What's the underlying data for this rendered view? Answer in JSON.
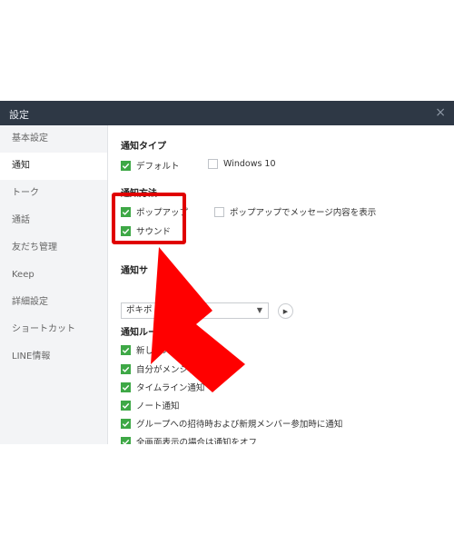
{
  "window": {
    "title": "設定",
    "close_glyph": "×"
  },
  "sidebar": {
    "items": [
      {
        "label": "基本設定",
        "active": false
      },
      {
        "label": "通知",
        "active": true
      },
      {
        "label": "トーク",
        "active": false
      },
      {
        "label": "通話",
        "active": false
      },
      {
        "label": "友だち管理",
        "active": false
      },
      {
        "label": "Keep",
        "active": false
      },
      {
        "label": "詳細設定",
        "active": false
      },
      {
        "label": "ショートカット",
        "active": false
      },
      {
        "label": "LINE情報",
        "active": false
      }
    ]
  },
  "main": {
    "notification_type": {
      "title": "通知タイプ",
      "options": [
        {
          "label": "デフォルト",
          "checked": true
        },
        {
          "label": "Windows 10",
          "checked": false
        }
      ]
    },
    "notification_method": {
      "title": "通知方法",
      "options": [
        {
          "label": "ポップアップ",
          "checked": true
        },
        {
          "label": "ポップアップでメッセージ内容を表示",
          "checked": false
        },
        {
          "label": "サウンド",
          "checked": true
        }
      ]
    },
    "notification_sound": {
      "title": "通知サ",
      "selected": "ポキポ",
      "caret": "▼",
      "play_icon": "▶"
    },
    "notification_rules": {
      "title": "通知ルール",
      "options": [
        {
          "label": "新しいメッセージ",
          "checked": true
        },
        {
          "label": "自分がメンションさ",
          "checked": true
        },
        {
          "label": "タイムライン通知",
          "checked": true
        },
        {
          "label": "ノート通知",
          "checked": true
        },
        {
          "label": "グループへの招待時および新規メンバー参加時に通知",
          "checked": true
        },
        {
          "label": "全画面表示の場合は通知をオフ",
          "checked": true
        }
      ]
    }
  },
  "colors": {
    "titlebar": "#2e3845",
    "checkbox_on": "#3ea846",
    "highlight": "#e00000",
    "arrow": "#ff0000"
  }
}
